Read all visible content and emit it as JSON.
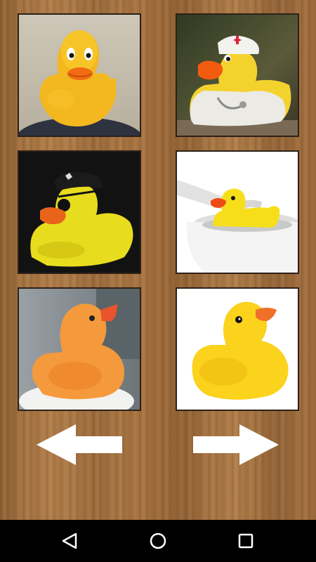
{
  "screen": "rubber-duck-image-grid",
  "gallery": {
    "tiles": [
      {
        "id": "duck-1",
        "subject": "classic-yellow-rubber-duck"
      },
      {
        "id": "duck-2",
        "subject": "nurse-rubber-duck"
      },
      {
        "id": "duck-3",
        "subject": "pirate-rubber-duck"
      },
      {
        "id": "duck-4",
        "subject": "duck-in-bathtub"
      },
      {
        "id": "duck-5",
        "subject": "orange-rubber-duck"
      },
      {
        "id": "duck-6",
        "subject": "yellow-duck-white-background"
      }
    ]
  },
  "navigation": {
    "previous": "arrow-left-icon",
    "next": "arrow-right-icon"
  },
  "system_nav": {
    "back": "back-triangle-icon",
    "home": "home-circle-icon",
    "recents": "recents-square-icon"
  },
  "colors": {
    "duck_yellow": "#f7c81e",
    "beak_orange": "#f36a12",
    "tile_border": "#2d2118",
    "navbar": "#000000"
  }
}
